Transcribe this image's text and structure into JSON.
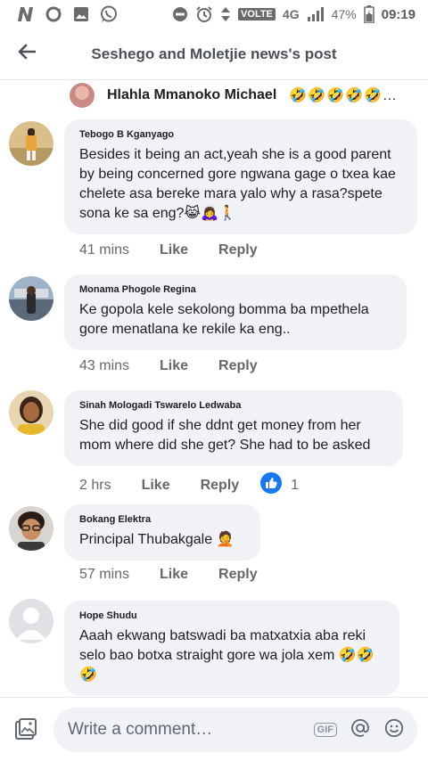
{
  "status_bar": {
    "network_label": "VOLTE",
    "network_type": "4G",
    "battery": "47%",
    "time": "09:19",
    "left_icons": [
      "n-logo-icon",
      "sync-icon",
      "gallery-icon",
      "whatsapp-icon"
    ],
    "right_icons": [
      "dnd-icon",
      "alarm-icon",
      "data-arrows-icon",
      "signal-icon",
      "battery-icon"
    ]
  },
  "header": {
    "title": "Seshego and Moletjie news's post",
    "back_icon": "arrow-left-icon"
  },
  "reactors": {
    "name": "Hlahla Mmanoko Michael",
    "emojis": "🤣🤣🤣🤣🤣…"
  },
  "comments": [
    {
      "author": "Tebogo B Kganyago",
      "text": "Besides it being an act,yeah she is a good parent by being concerned gore ngwana gage o txea kae chelete asa bereke mara yalo why a rasa?spete sona ke sa eng?😹🙇‍♀️🚶",
      "time": "41 mins",
      "like_label": "Like",
      "reply_label": "Reply"
    },
    {
      "author": "Monama Phogole Regina",
      "text": "Ke gopola kele sekolong bomma ba mpethela gore menatlana ke rekile ka eng..",
      "time": "43 mins",
      "like_label": "Like",
      "reply_label": "Reply"
    },
    {
      "author": "Sinah Mologadi Tswarelo Ledwaba",
      "text": "She did good if she ddnt get money from her mom where did she get? She had to be asked",
      "time": "2 hrs",
      "like_label": "Like",
      "reply_label": "Reply",
      "reaction_count": "1"
    },
    {
      "author": "Bokang Elektra",
      "text": "Principal Thubakgale 🤦",
      "time": "57 mins",
      "like_label": "Like",
      "reply_label": "Reply"
    },
    {
      "author": "Hope Shudu",
      "text": "Aaah ekwang batswadi ba matxatxia aba reki selo bao botxa straight gore wa jola xem 🤣🤣🤣",
      "time": "",
      "like_label": "",
      "reply_label": ""
    }
  ],
  "composer": {
    "placeholder": "Write a comment…",
    "gif_label": "GIF"
  },
  "colors": {
    "bubble": "#f0f2f5",
    "like_blue": "#1877f2",
    "meta_gray": "#65676b"
  }
}
